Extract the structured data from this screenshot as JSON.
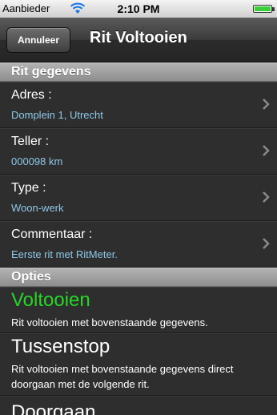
{
  "status": {
    "carrier": "Aanbieder",
    "time": "2:10 PM",
    "wifi_icon": "wifi-icon",
    "battery_icon": "battery-icon"
  },
  "nav": {
    "cancel_label": "Annuleer",
    "title": "Rit Voltooien"
  },
  "sections": {
    "details_header": "Rit gegevens",
    "options_header": "Opties"
  },
  "details": [
    {
      "label": "Adres :",
      "value": "Domplein 1, Utrecht"
    },
    {
      "label": "Teller :",
      "value": "000098 km"
    },
    {
      "label": "Type :",
      "value": "Woon-werk"
    },
    {
      "label": "Commentaar :",
      "value": "Eerste rit met RitMeter."
    }
  ],
  "options": [
    {
      "title": "Voltooien",
      "description": "Rit voltooien met bovenstaande gegevens.",
      "title_color": "#27d627"
    },
    {
      "title": "Tussenstop",
      "description": "Rit voltooien met bovenstaande gegevens direct doorgaan met de volgende rit.",
      "title_color": "#ffffff"
    },
    {
      "title": "Doorgaan",
      "description": "",
      "title_color": "#ffffff"
    }
  ],
  "colors": {
    "value_text": "#8fc8ea",
    "accent_green": "#27d627"
  }
}
